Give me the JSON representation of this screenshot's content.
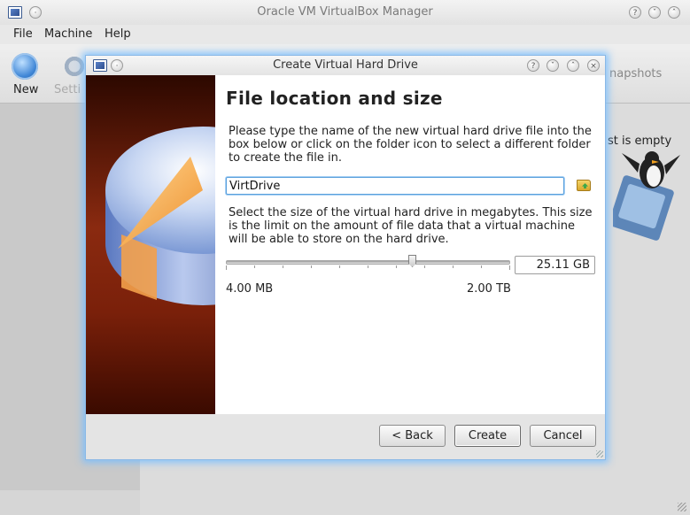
{
  "main_window": {
    "title": "Oracle VM VirtualBox Manager",
    "menu": [
      {
        "label": "File"
      },
      {
        "label": "Machine"
      },
      {
        "label": "Help"
      }
    ],
    "toolbar": {
      "new_label": "New",
      "settings_label": "Setti",
      "snapshots_label": "napshots"
    },
    "empty_list_text": "st is empty"
  },
  "dialog": {
    "title": "Create Virtual Hard Drive",
    "heading": "File location and size",
    "location_description": "Please type the name of the new virtual hard drive file into the box below or click on the folder icon to select a different folder to create the file in.",
    "file_name_value": "VirtDrive",
    "size_description": "Select the size of the virtual hard drive in megabytes. This size is the limit on the amount of file data that a virtual machine will be able to store on the hard drive.",
    "size_value": "25.11 GB",
    "slider_level": 0.66,
    "range_min": "4.00 MB",
    "range_max": "2.00 TB",
    "buttons": {
      "back": "< Back",
      "create": "Create",
      "cancel": "Cancel"
    },
    "title_buttons": [
      "?",
      "v",
      "^",
      "x"
    ]
  },
  "colors": {
    "focus_glow": "#78beff",
    "banner_dark": "#2c0800",
    "banner_mid": "#8a2a10",
    "input_focus": "#5aa0dc"
  }
}
